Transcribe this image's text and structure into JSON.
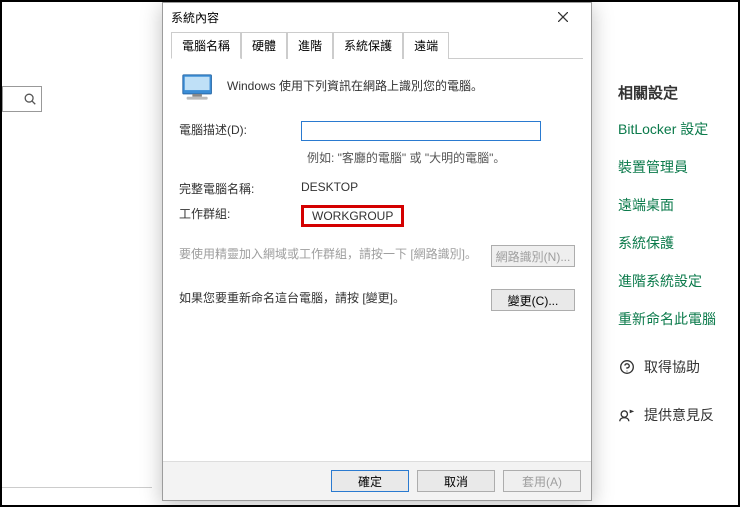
{
  "bg": {
    "search_placeholder": ""
  },
  "sidebar": {
    "heading": "相關設定",
    "links": {
      "bitlocker": "BitLocker 設定",
      "devmgr": "裝置管理員",
      "remote": "遠端桌面",
      "sysprotect": "系統保護",
      "advanced": "進階系統設定",
      "rename": "重新命名此電腦"
    },
    "help": "取得協助",
    "feedback": "提供意見反"
  },
  "dialog": {
    "title": "系統內容",
    "tabs": {
      "computer_name": "電腦名稱",
      "hardware": "硬體",
      "advanced": "進階",
      "sysprotect": "系統保護",
      "remote": "遠端"
    },
    "intro": "Windows 使用下列資訊在網路上識別您的電腦。",
    "desc_label": "電腦描述(D):",
    "desc_value": "",
    "desc_hint": "例如: \"客廳的電腦\" 或 \"大明的電腦\"。",
    "fullname_label": "完整電腦名稱:",
    "fullname_value": "DESKTOP",
    "workgroup_label": "工作群組:",
    "workgroup_value": "WORKGROUP",
    "netid_text": "要使用精靈加入網域或工作群組，請按一下 [網路識別]。",
    "netid_btn": "網路識別(N)...",
    "change_text": "如果您要重新命名這台電腦，請按 [變更]。",
    "change_btn": "變更(C)...",
    "footer": {
      "ok": "確定",
      "cancel": "取消",
      "apply": "套用(A)"
    }
  }
}
